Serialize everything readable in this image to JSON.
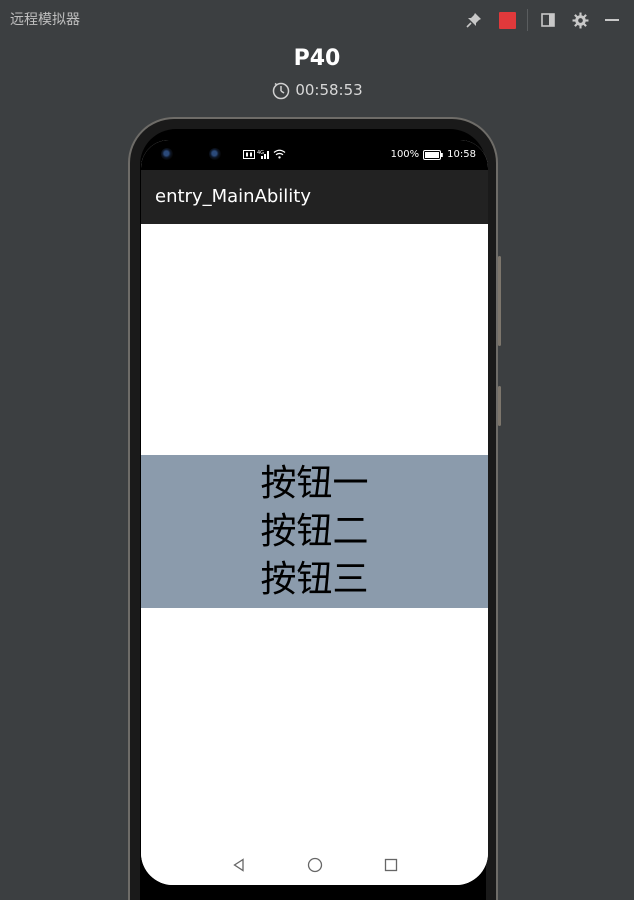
{
  "window": {
    "title": "远程模拟器",
    "icons": [
      "pin-icon",
      "stop-icon",
      "dock-panel-icon",
      "gear-icon",
      "minimize-icon"
    ],
    "colors": {
      "stop": "#e0393b"
    }
  },
  "device": {
    "name": "P40",
    "timer": "00:58:53",
    "timer_icon": "stopwatch-icon"
  },
  "status_bar": {
    "battery": "100%",
    "time": "10:58",
    "icons": [
      "camera-icon",
      "camera-icon",
      "sim-icon",
      "signal-icon",
      "wifi-icon",
      "battery-icon"
    ]
  },
  "app": {
    "title": "entry_MainAbility",
    "buttons": [
      "按钮一",
      "按钮二",
      "按钮三"
    ],
    "colors": {
      "column_background": "#8b9bac",
      "appbar": "#222222"
    }
  },
  "nav_bar": {
    "icons": [
      "back-triangle-icon",
      "home-circle-icon",
      "recents-square-icon"
    ]
  }
}
